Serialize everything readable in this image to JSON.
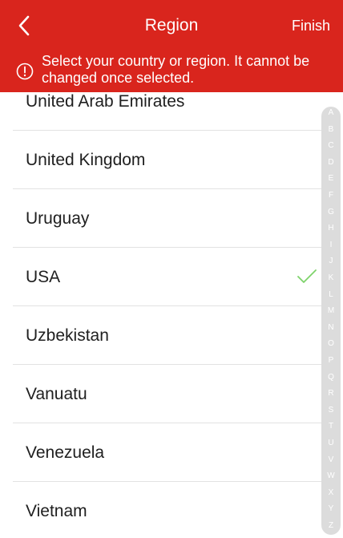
{
  "header": {
    "title": "Region",
    "finish_label": "Finish",
    "back_icon": "chevron-left-icon",
    "notice": {
      "icon": "exclamation-circle-icon",
      "text": "Select your country or region. It cannot be changed once selected."
    },
    "bg_color": "#d9251d"
  },
  "regions": {
    "items": [
      {
        "label": "United Arab Emirates",
        "selected": false
      },
      {
        "label": "United Kingdom",
        "selected": false
      },
      {
        "label": "Uruguay",
        "selected": false
      },
      {
        "label": "USA",
        "selected": true
      },
      {
        "label": "Uzbekistan",
        "selected": false
      },
      {
        "label": "Vanuatu",
        "selected": false
      },
      {
        "label": "Venezuela",
        "selected": false
      },
      {
        "label": "Vietnam",
        "selected": false
      }
    ],
    "check_icon": "checkmark-icon",
    "check_color": "#7ed36b"
  },
  "index_bar": {
    "letters": [
      "A",
      "B",
      "C",
      "D",
      "E",
      "F",
      "G",
      "H",
      "I",
      "J",
      "K",
      "L",
      "M",
      "N",
      "O",
      "P",
      "Q",
      "R",
      "S",
      "T",
      "U",
      "V",
      "W",
      "X",
      "Y",
      "Z"
    ]
  }
}
